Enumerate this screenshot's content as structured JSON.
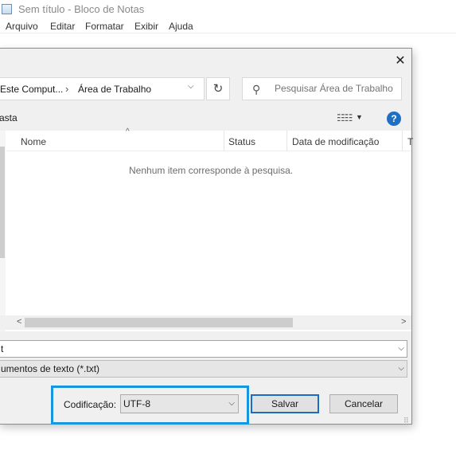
{
  "notepad": {
    "title": "Sem título - Bloco de Notas",
    "menu": [
      "Arquivo",
      "Editar",
      "Formatar",
      "Exibir",
      "Ajuda"
    ]
  },
  "dialog": {
    "close_glyph": "✕",
    "breadcrumb": {
      "first": "Este Comput...",
      "separator": "›",
      "second": "Área de Trabalho",
      "dropdown_glyph": "⌵"
    },
    "refresh_glyph": "↻",
    "search": {
      "icon_glyph": "⚲",
      "placeholder": "Pesquisar Área de Trabalho"
    },
    "commands": {
      "new_folder": "asta",
      "view_glyph": "☷☷",
      "view_caret": "▼",
      "help_glyph": "?"
    },
    "columns": {
      "name": "Nome",
      "status": "Status",
      "date": "Data de modificação",
      "type": "T",
      "sort_caret": "^"
    },
    "empty_message": "Nenhum item corresponde à pesquisa.",
    "scroll": {
      "left": "<",
      "right": ">"
    },
    "filename": {
      "value": "t",
      "arrow": "⌵"
    },
    "filetype": {
      "value": "umentos de texto (*.txt)",
      "arrow": "⌵"
    },
    "encoding": {
      "label": "Codificação:",
      "value": "UTF-8",
      "arrow": "⌵",
      "highlight_color": "#1696df"
    },
    "buttons": {
      "save": "Salvar",
      "cancel": "Cancelar"
    }
  },
  "icons": [
    "notepad-app-icon",
    "close-icon",
    "chevron-right-icon",
    "chevron-down-icon",
    "refresh-icon",
    "search-icon",
    "view-options-icon",
    "help-icon",
    "scroll-left-icon",
    "scroll-right-icon",
    "resize-grip-icon"
  ]
}
